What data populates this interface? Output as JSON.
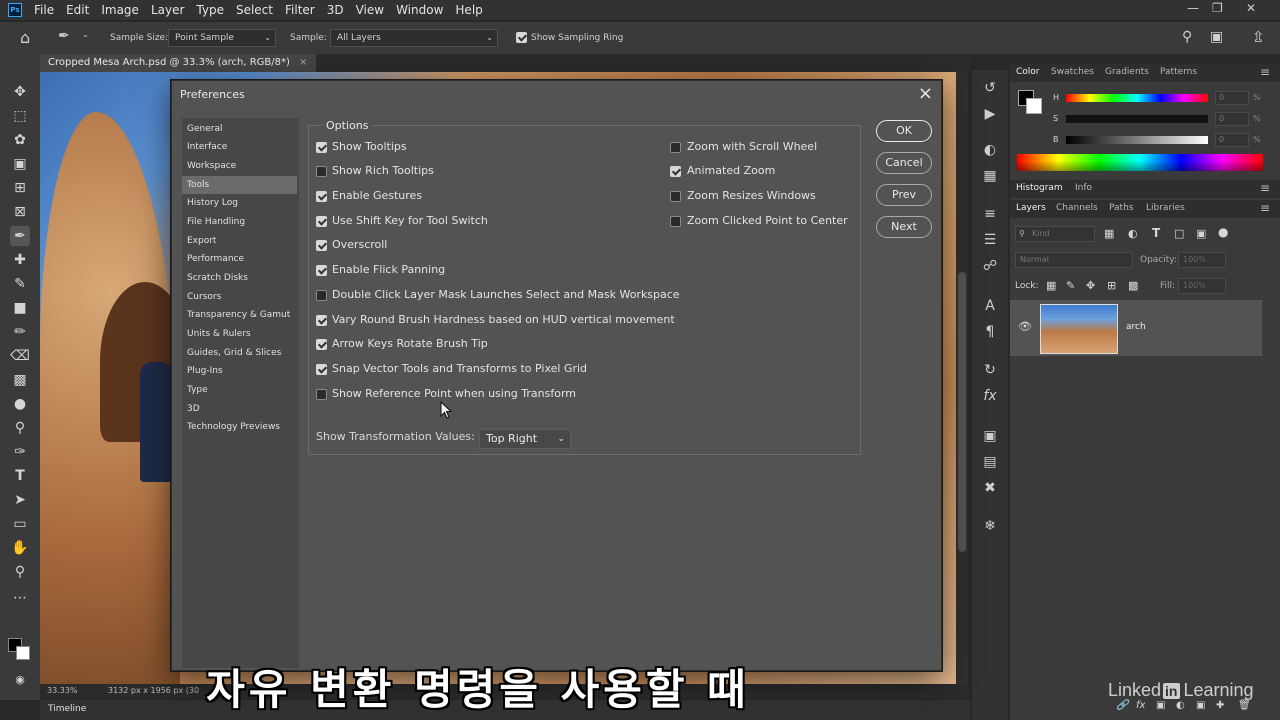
{
  "menubar": {
    "items": [
      "File",
      "Edit",
      "Image",
      "Layer",
      "Type",
      "Select",
      "Filter",
      "3D",
      "View",
      "Window",
      "Help"
    ]
  },
  "optionsbar": {
    "sample_size_label": "Sample Size:",
    "sample_size_value": "Point Sample",
    "sample_label": "Sample:",
    "sample_value": "All Layers",
    "show_sampling_ring": "Show Sampling Ring"
  },
  "document": {
    "tab_title": "Cropped Mesa Arch.psd @ 33.3% (arch, RGB/8*)",
    "zoom": "33.33%",
    "dimensions": "3132 px x 1956 px (30"
  },
  "timeline": {
    "label": "Timeline"
  },
  "panels": {
    "color_tabs": [
      "Color",
      "Swatches",
      "Gradients",
      "Patterns"
    ],
    "hsb": [
      "H",
      "S",
      "B"
    ],
    "pct": [
      "%",
      "%",
      "%"
    ],
    "pct_values": [
      "0",
      "0",
      "0"
    ],
    "hist_tabs": [
      "Histogram",
      "Info"
    ],
    "layer_tabs": [
      "Layers",
      "Channels",
      "Paths",
      "Libraries"
    ],
    "kind_label": "Kind",
    "blend_mode": "Normal",
    "opacity_label": "Opacity:",
    "opacity_value": "100%",
    "lock_label": "Lock:",
    "fill_label": "Fill:",
    "fill_value": "100%",
    "layer_name": "arch"
  },
  "dialog": {
    "title": "Preferences",
    "categories": [
      "General",
      "Interface",
      "Workspace",
      "Tools",
      "History Log",
      "File Handling",
      "Export",
      "Performance",
      "Scratch Disks",
      "Cursors",
      "Transparency & Gamut",
      "Units & Rulers",
      "Guides, Grid & Slices",
      "Plug-Ins",
      "Type",
      "3D",
      "Technology Previews"
    ],
    "options_legend": "Options",
    "left_options": [
      {
        "label": "Show Tooltips",
        "checked": true
      },
      {
        "label": "Show Rich Tooltips",
        "checked": false
      },
      {
        "label": "Enable Gestures",
        "checked": true
      },
      {
        "label": "Use Shift Key for Tool Switch",
        "checked": true
      },
      {
        "label": "Overscroll",
        "checked": true
      },
      {
        "label": "Enable Flick Panning",
        "checked": true
      },
      {
        "label": "Double Click Layer Mask Launches Select and Mask Workspace",
        "checked": false
      },
      {
        "label": "Vary Round Brush Hardness based on HUD vertical movement",
        "checked": true
      },
      {
        "label": "Arrow Keys Rotate Brush Tip",
        "checked": true
      },
      {
        "label": "Snap Vector Tools and Transforms to Pixel Grid",
        "checked": true
      },
      {
        "label": "Show Reference Point when using Transform",
        "checked": false
      }
    ],
    "right_options": [
      {
        "label": "Zoom with Scroll Wheel",
        "checked": false
      },
      {
        "label": "Animated Zoom",
        "checked": true
      },
      {
        "label": "Zoom Resizes Windows",
        "checked": false
      },
      {
        "label": "Zoom Clicked Point to Center",
        "checked": false
      }
    ],
    "transform_values_label": "Show Transformation Values:",
    "transform_values_value": "Top Right",
    "buttons": {
      "ok": "OK",
      "cancel": "Cancel",
      "prev": "Prev",
      "next": "Next"
    }
  },
  "subtitle": "자유 변환 명령을 사용할 때",
  "watermark": {
    "pre": "Linked",
    "in": "in",
    "post": "Learning"
  }
}
